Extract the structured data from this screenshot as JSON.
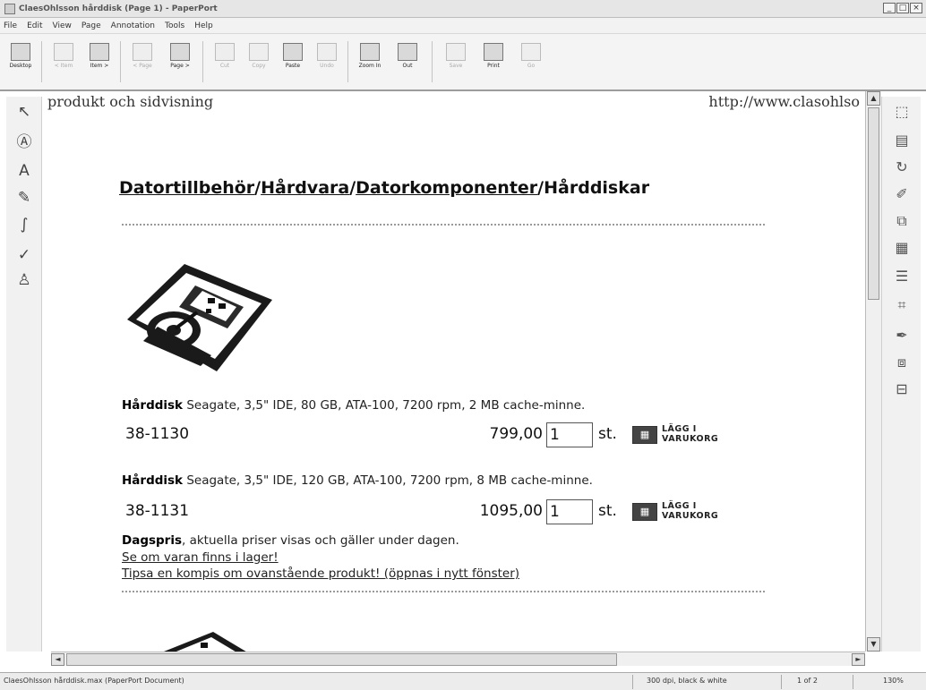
{
  "window": {
    "title": "ClaesOhlsson hårddisk (Page 1) - PaperPort",
    "controls": [
      "_",
      "□",
      "×"
    ]
  },
  "menu": [
    "File",
    "Edit",
    "View",
    "Page",
    "Annotation",
    "Tools",
    "Help"
  ],
  "toolbar": {
    "buttons": [
      {
        "label": "Desktop",
        "icon": "desktop-icon",
        "enabled": true
      },
      {
        "label": "< Item",
        "icon": "prev-item-icon",
        "enabled": false
      },
      {
        "label": "Item >",
        "icon": "next-item-icon",
        "enabled": true
      },
      {
        "label": "< Page",
        "icon": "prev-page-icon",
        "enabled": false
      },
      {
        "label": "Page >",
        "icon": "next-page-icon",
        "enabled": true
      },
      {
        "label": "Cut",
        "icon": "scissors-icon",
        "enabled": false
      },
      {
        "label": "Copy",
        "icon": "copy-icon",
        "enabled": false
      },
      {
        "label": "Paste",
        "icon": "paste-icon",
        "enabled": true
      },
      {
        "label": "Undo",
        "icon": "undo-icon",
        "enabled": false
      },
      {
        "label": "Zoom In",
        "icon": "zoom-in-icon",
        "enabled": true
      },
      {
        "label": "Out",
        "icon": "zoom-out-icon",
        "enabled": true
      },
      {
        "label": "Save",
        "icon": "save-icon",
        "enabled": false
      },
      {
        "label": "Print",
        "icon": "print-icon",
        "enabled": true
      },
      {
        "label": "Go",
        "icon": "go-icon",
        "enabled": false
      }
    ]
  },
  "left_tools": [
    {
      "name": "pointer-tool-icon",
      "glyph": "↖"
    },
    {
      "name": "text-annotation-tool-icon",
      "glyph": "Ⓐ"
    },
    {
      "name": "text-tool-icon",
      "glyph": "A"
    },
    {
      "name": "highlighter-tool-icon",
      "glyph": "✎"
    },
    {
      "name": "freehand-pen-tool-icon",
      "glyph": "∫"
    },
    {
      "name": "checkmark-tool-icon",
      "glyph": "✓"
    },
    {
      "name": "stamp-tool-icon",
      "glyph": "♙"
    }
  ],
  "right_tools": [
    {
      "name": "select-area-icon",
      "glyph": "⬚"
    },
    {
      "name": "page-thumbnails-icon",
      "glyph": "▤"
    },
    {
      "name": "rotate-page-icon",
      "glyph": "↻"
    },
    {
      "name": "page-edit-icon",
      "glyph": "✐"
    },
    {
      "name": "page-copy-icon",
      "glyph": "⧉"
    },
    {
      "name": "page-view-icon",
      "glyph": "▦"
    },
    {
      "name": "straighten-icon",
      "glyph": "☰"
    },
    {
      "name": "crop-icon",
      "glyph": "⌗"
    },
    {
      "name": "eyedropper-icon",
      "glyph": "✒"
    },
    {
      "name": "stack-pages-icon",
      "glyph": "⧈"
    },
    {
      "name": "unstack-pages-icon",
      "glyph": "⊟"
    }
  ],
  "document": {
    "header_left": "produkt och sidvisning",
    "header_right": "http://www.clasohlso",
    "breadcrumb": {
      "items": [
        "Datortillbehör",
        "Hårdvara",
        "Datorkomponenter"
      ],
      "sep": "/",
      "current": "Hårddiskar"
    },
    "products": [
      {
        "name": "Hårddisk",
        "desc": " Seagate, 3,5\" IDE, 80 GB, ATA-100, 7200 rpm, 2 MB cache-minne.",
        "sku": "38-1130",
        "price": "799,00",
        "qty": "1",
        "unit": "st.",
        "cart_line1": "LÄGG I",
        "cart_line2": "VARUKORG"
      },
      {
        "name": "Hårddisk",
        "desc": " Seagate, 3,5\" IDE, 120 GB, ATA-100, 7200 rpm, 8 MB cache-minne.",
        "sku": "38-1131",
        "price": "1095,00",
        "qty": "1",
        "unit": "st.",
        "cart_line1": "LÄGG I",
        "cart_line2": "VARUKORG"
      }
    ],
    "dagspris_bold": "Dagspris",
    "dagspris_text": ", aktuella priser visas och gäller under dagen.",
    "stock_link": "Se om varan finns i lager!",
    "tip_link": "Tipsa en kompis om ovanstående produkt! (öppnas i nytt fönster)"
  },
  "status": {
    "file": "ClaesOhlsson hårddisk.max (PaperPort Document)",
    "resolution": "300 dpi, black & white",
    "page": "1 of 2",
    "zoom": "130%"
  }
}
